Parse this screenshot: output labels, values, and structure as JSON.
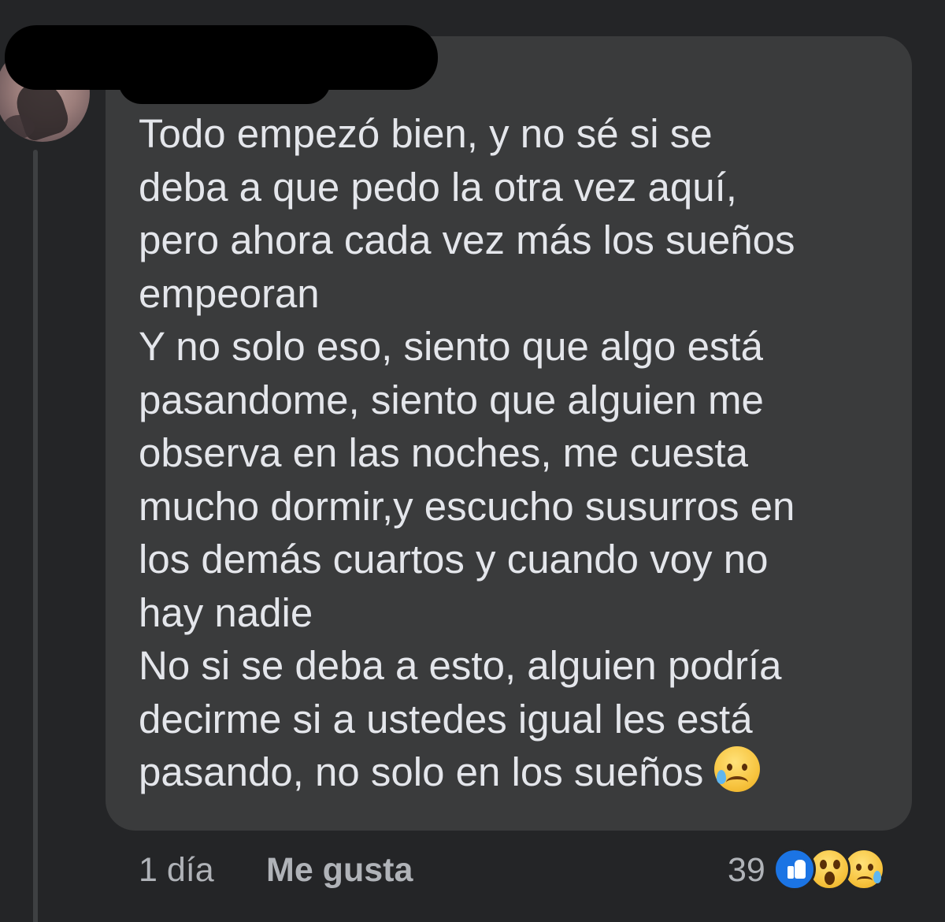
{
  "comment": {
    "text": "Todo empezó bien, y no sé si se\ndeba a que pedo la otra vez aquí,\npero ahora cada vez más los sueños\nempeoran\nY no solo eso, siento que algo está\npasandome, siento que alguien me\nobserva en las noches, me cuesta\nmucho dormir,y escucho susurros en\nlos demás cuartos y cuando voy no\nhay nadie\nNo si se deba a esto, alguien podría\ndecirme si a ustedes igual les está\npasando, no solo en los sueños",
    "trailing_emoji": "sad-but-relieved-face-icon"
  },
  "meta": {
    "time": "1 día",
    "like_label": "Me gusta"
  },
  "reactions": {
    "count": "39",
    "icons": [
      "like-reaction-icon",
      "wow-reaction-icon",
      "sad-reaction-icon"
    ],
    "like_color": "#1b74e4"
  },
  "theme": {
    "background": "#242527",
    "bubble": "#3a3b3c",
    "text": "#e4e6eb",
    "muted": "#b0b3b8"
  }
}
